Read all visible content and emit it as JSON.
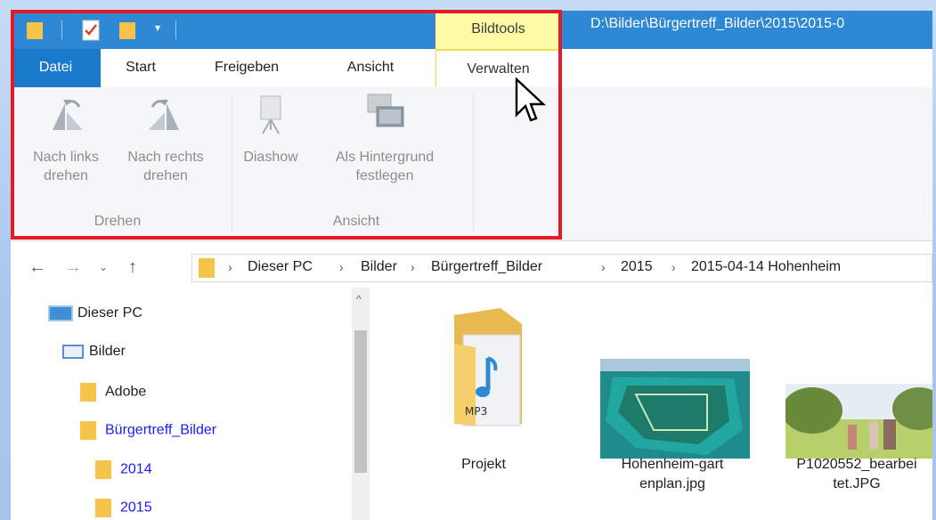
{
  "titlebar": {
    "path": "D:\\Bilder\\Bürgertreff_Bilder\\2015\\2015-0",
    "context_tab": "Bildtools",
    "qa_icons": [
      "folder-icon",
      "properties-icon",
      "new-folder-icon",
      "customize-dropdown-icon"
    ]
  },
  "tabs": {
    "datei": "Datei",
    "start": "Start",
    "freigeben": "Freigeben",
    "ansicht": "Ansicht",
    "verwalten": "Verwalten"
  },
  "ribbon": {
    "rotate_left": {
      "line1": "Nach links",
      "line2": "drehen"
    },
    "rotate_right": {
      "line1": "Nach rechts",
      "line2": "drehen"
    },
    "group_rotate": "Drehen",
    "slideshow": {
      "line1": "Diashow"
    },
    "set_background": {
      "line1": "Als Hintergrund",
      "line2": "festlegen"
    },
    "group_view": "Ansicht"
  },
  "nav": {
    "crumbs": [
      "Dieser PC",
      "Bilder",
      "Bürgertreff_Bilder",
      "2015",
      "2015-04-14 Hohenheim"
    ]
  },
  "tree": {
    "items": [
      "Dieser PC",
      "Bilder",
      "Adobe",
      "Bürgertreff_Bilder",
      "2014",
      "2015"
    ]
  },
  "files": [
    {
      "name_line1": "Projekt",
      "name_line2": ""
    },
    {
      "name_line1": "Hohenheim-gart",
      "name_line2": "enplan.jpg"
    },
    {
      "name_line1": "P1020552_bearbei",
      "name_line2": "tet.JPG"
    }
  ],
  "colors": {
    "titlebar": "#2f88d4",
    "datei_tab": "#1979ca",
    "context": "#fffaa6",
    "highlight": "#e21b25",
    "tree_selected_text": "#1a1aff"
  }
}
